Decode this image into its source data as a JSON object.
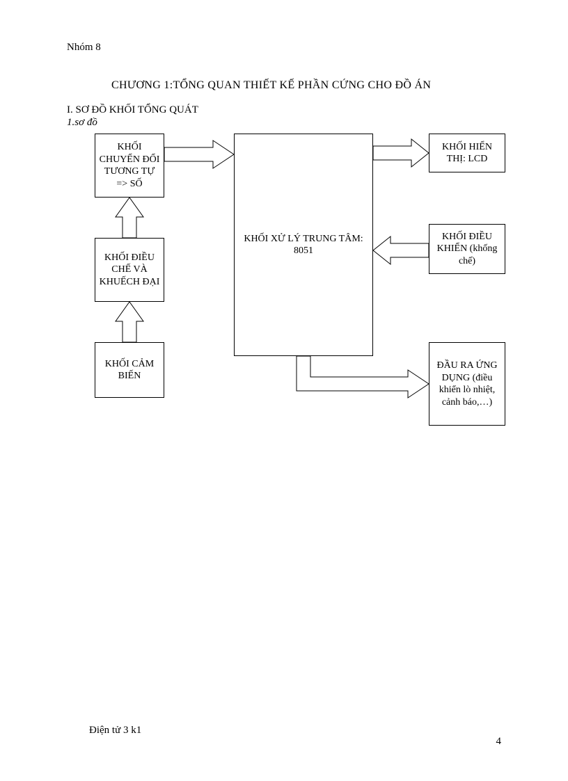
{
  "page": {
    "header": "Nhóm 8",
    "chapter_title": "CHƯƠNG 1:TỔNG QUAN THIẾT KẾ PHẦN CỨNG CHO ĐỒ ÁN",
    "section_title": "I. SƠ ĐỒ KHỐI TỔNG QUÁT",
    "subsection_title": "1.sơ đồ",
    "footer_left": "Điện tử 3 k1",
    "page_number": "4"
  },
  "blocks": {
    "adc": "KHỐI CHUYỂN ĐỔI TƯƠNG TỰ => SỐ",
    "amp": "KHỐI ĐIỀU CHẾ VÀ KHUẾCH ĐẠI",
    "sensor": "KHỐI CẢM BIẾN",
    "cpu": "KHỐI XỬ LÝ TRUNG TÂM: 8051",
    "lcd": "KHỐI HIỂN THỊ: LCD",
    "control": "KHỐI ĐIỀU KHIỂN (khống chế)",
    "output": "ĐẦU RA ỨNG DỤNG (điều khiển lò nhiệt, cảnh báo,…)"
  }
}
